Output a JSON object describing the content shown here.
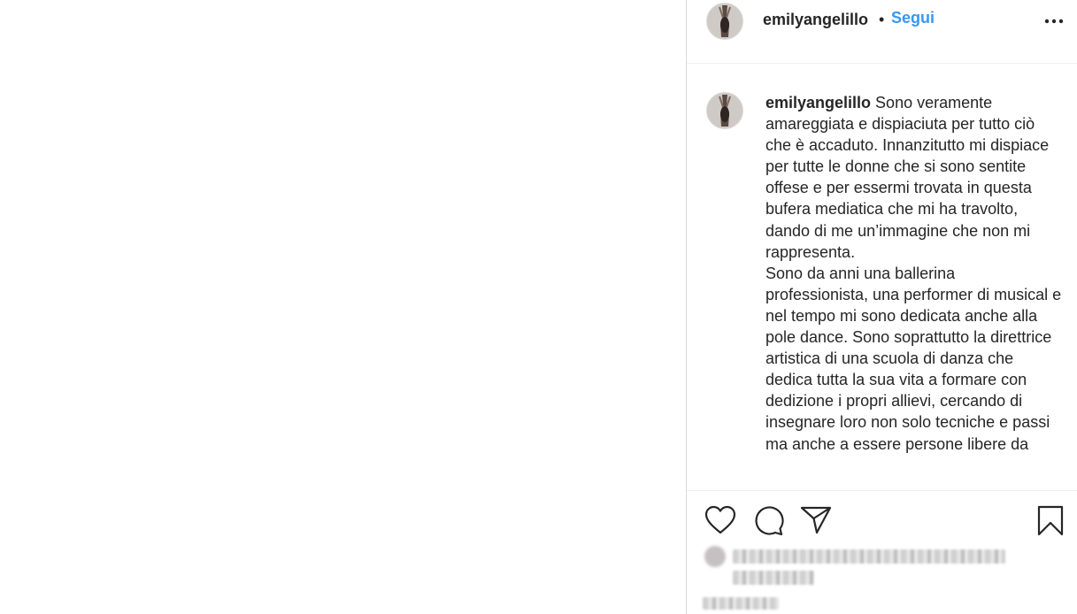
{
  "post": {
    "username": "emilyangelillo",
    "separator": "•",
    "follow_label": "Segui",
    "caption": "Sono veramente amareggiata e dispiaciuta per tutto ciò che è accaduto. Innanzitutto mi dispiace per tutte le donne che si sono sentite offese e per essermi trovata in questa bufera mediatica che mi ha travolto, dando di me un’immagine che non mi rappresenta.\nSono da anni una ballerina professionista, una performer di musical e nel tempo mi sono dedicata anche alla pole dance. Sono soprattutto la direttrice artistica di una scuola di danza che dedica tutta la sua vita a formare con dedizione i propri allievi, cercando di insegnare loro non solo tecniche e passi ma anche a essere persone libere da"
  },
  "icons": {
    "more": "more-options-icon",
    "like": "heart-icon",
    "comment": "comment-bubble-icon",
    "share": "paper-plane-icon",
    "save": "bookmark-icon"
  },
  "colors": {
    "follow": "#3897f0",
    "text": "#262626",
    "border": "#dbdbdb"
  }
}
